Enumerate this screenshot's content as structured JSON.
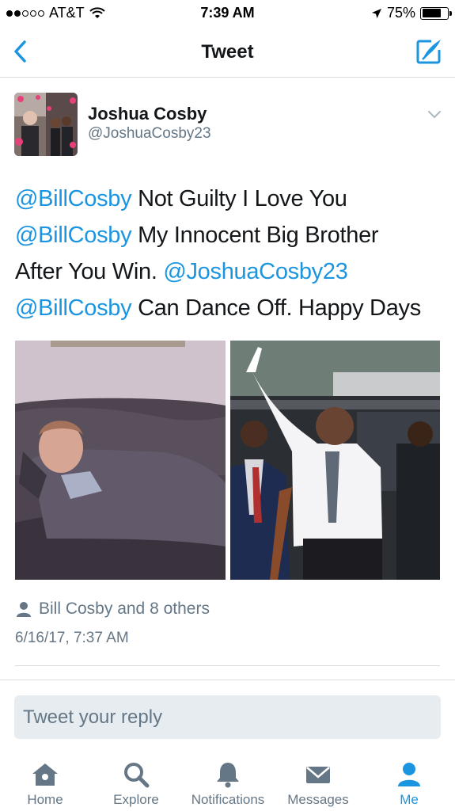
{
  "status": {
    "carrier": "AT&T",
    "time": "7:39 AM",
    "battery": "75%",
    "battery_level": 0.75,
    "signal_bars_filled": 2,
    "signal_bars_total": 5
  },
  "nav": {
    "title": "Tweet",
    "back_icon": "chevron-left-icon",
    "compose_icon": "compose-tweet-icon"
  },
  "tweet": {
    "author_name": "Joshua Cosby",
    "author_handle": "@JoshuaCosby23",
    "lines": [
      [
        {
          "text": "@BillCosby",
          "mention": true
        },
        {
          "text": " Not Guilty I Love You",
          "mention": false
        }
      ],
      [
        {
          "text": "@BillCosby",
          "mention": true
        },
        {
          "text": " My Innocent Big Brother",
          "mention": false
        }
      ],
      [
        {
          "text": "After You Win. ",
          "mention": false
        },
        {
          "text": "@JoshuaCosby23",
          "mention": true
        }
      ],
      [
        {
          "text": "@BillCosby",
          "mention": true
        },
        {
          "text": " Can Dance Off. Happy Days",
          "mention": false
        }
      ]
    ],
    "liked_by": "Bill Cosby and 8 others",
    "timestamp": "6/16/17, 7:37 AM"
  },
  "reply": {
    "placeholder": "Tweet your reply"
  },
  "tabs": [
    {
      "label": "Home",
      "icon": "home-icon",
      "active": false
    },
    {
      "label": "Explore",
      "icon": "search-icon",
      "active": false
    },
    {
      "label": "Notifications",
      "icon": "bell-icon",
      "active": false
    },
    {
      "label": "Messages",
      "icon": "envelope-icon",
      "active": false
    },
    {
      "label": "Me",
      "icon": "person-icon",
      "active": true
    }
  ],
  "colors": {
    "accent": "#1b95e0",
    "muted": "#657786",
    "reply_bg": "#e6ecf0"
  }
}
